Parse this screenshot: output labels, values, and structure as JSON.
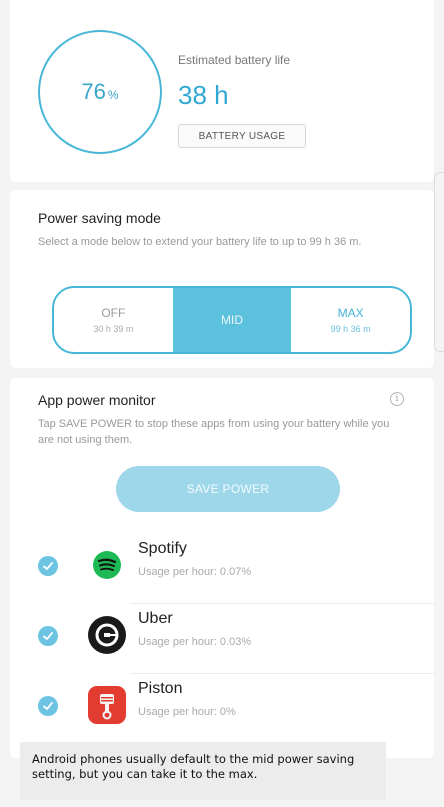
{
  "battery": {
    "percent": "76",
    "percent_sign": "%",
    "estimated_label": "Estimated battery life",
    "estimated_value": "38 h",
    "usage_button": "BATTERY USAGE"
  },
  "power_saving": {
    "title": "Power saving mode",
    "description": "Select a mode below to extend your battery life to up to 99 h 36 m.",
    "modes": [
      {
        "label": "OFF",
        "sub": "30 h 39 m",
        "selected": false
      },
      {
        "label": "MID",
        "sub": "",
        "selected": true
      },
      {
        "label": "MAX",
        "sub": "99 h 36 m",
        "selected": false
      }
    ]
  },
  "app_monitor": {
    "title": "App power monitor",
    "info_icon": "info-icon",
    "description": "Tap SAVE POWER to stop these apps from using your battery while you are not using them.",
    "save_button": "SAVE POWER",
    "apps": [
      {
        "name": "Spotify",
        "usage": "Usage per hour: 0.07%",
        "checked": true,
        "icon": "spotify-icon"
      },
      {
        "name": "Uber",
        "usage": "Usage per hour: 0.03%",
        "checked": true,
        "icon": "uber-icon"
      },
      {
        "name": "Piston",
        "usage": "Usage per hour: 0%",
        "checked": true,
        "icon": "piston-icon"
      }
    ]
  },
  "caption": "Android phones usually default to the mid power saving setting, but you can take it to the max.",
  "colors": {
    "accent": "#49b7d8",
    "mid_selected": "#5cc1dd",
    "save_button": "#9fd7ea",
    "check": "#6cc3e2"
  }
}
